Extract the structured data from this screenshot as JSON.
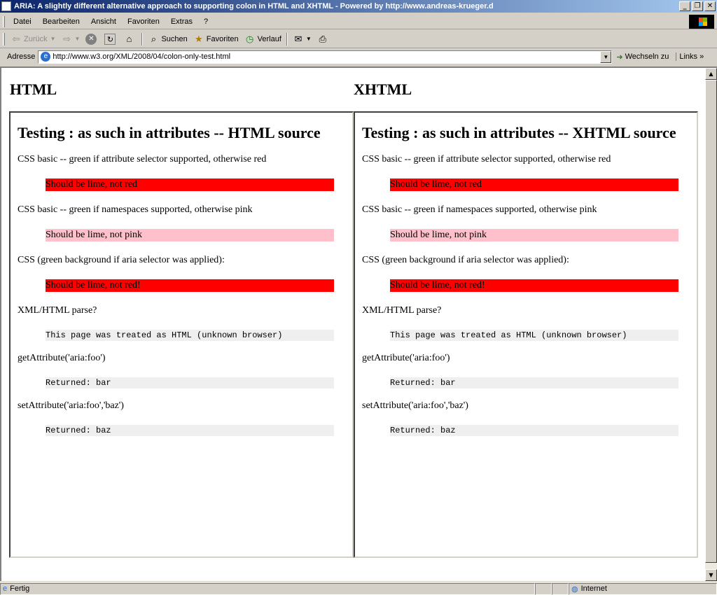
{
  "window": {
    "title": "ARIA: A slightly different alternative approach to supporting colon in HTML and XHTML - Powered by http://www.andreas-krueger.d",
    "minimize": "_",
    "maximize": "❐",
    "close": "✕"
  },
  "menu": [
    "Datei",
    "Bearbeiten",
    "Ansicht",
    "Favoriten",
    "Extras",
    "?"
  ],
  "toolbar": {
    "back": "Zurück",
    "search": "Suchen",
    "favorites": "Favoriten",
    "history": "Verlauf"
  },
  "address": {
    "label": "Adresse",
    "url": "http://www.w3.org/XML/2008/04/colon-only-test.html",
    "go": "Wechseln zu",
    "links": "Links"
  },
  "page": {
    "html_heading": "HTML",
    "xhtml_heading": "XHTML",
    "html_frame": {
      "title": "Testing : as such in attributes -- HTML source",
      "test1_label": "CSS basic -- green if attribute selector supported, otherwise red",
      "test1_result": "Should be lime, not red",
      "test2_label": "CSS basic -- green if namespaces supported, otherwise pink",
      "test2_result": "Should be lime, not pink",
      "test3_label": "CSS (green background if aria selector was applied):",
      "test3_result": "Should be lime, not red!",
      "test4_label": "XML/HTML parse?",
      "test4_result": "This page was treated as HTML (unknown browser)",
      "test5_label": "getAttribute('aria:foo')",
      "test5_result": "Returned: bar",
      "test6_label": "setAttribute('aria:foo','baz')",
      "test6_result": "Returned: baz"
    },
    "xhtml_frame": {
      "title": "Testing : as such in attributes -- XHTML source",
      "test1_label": "CSS basic -- green if attribute selector supported, otherwise red",
      "test1_result": "Should be lime, not red",
      "test2_label": "CSS basic -- green if namespaces supported, otherwise pink",
      "test2_result": "Should be lime, not pink",
      "test3_label": "CSS (green background if aria selector was applied):",
      "test3_result": "Should be lime, not red!",
      "test4_label": "XML/HTML parse?",
      "test4_result": "This page was treated as HTML (unknown browser)",
      "test5_label": "getAttribute('aria:foo')",
      "test5_result": "Returned: bar",
      "test6_label": "setAttribute('aria:foo','baz')",
      "test6_result": "Returned: baz"
    }
  },
  "status": {
    "text": "Fertig",
    "zone": "Internet"
  },
  "colors": {
    "title_start": "#0a246a",
    "title_end": "#a6caf0",
    "red": "#ff0000",
    "pink": "#ffc0cb",
    "mono_bg": "#efefef"
  }
}
